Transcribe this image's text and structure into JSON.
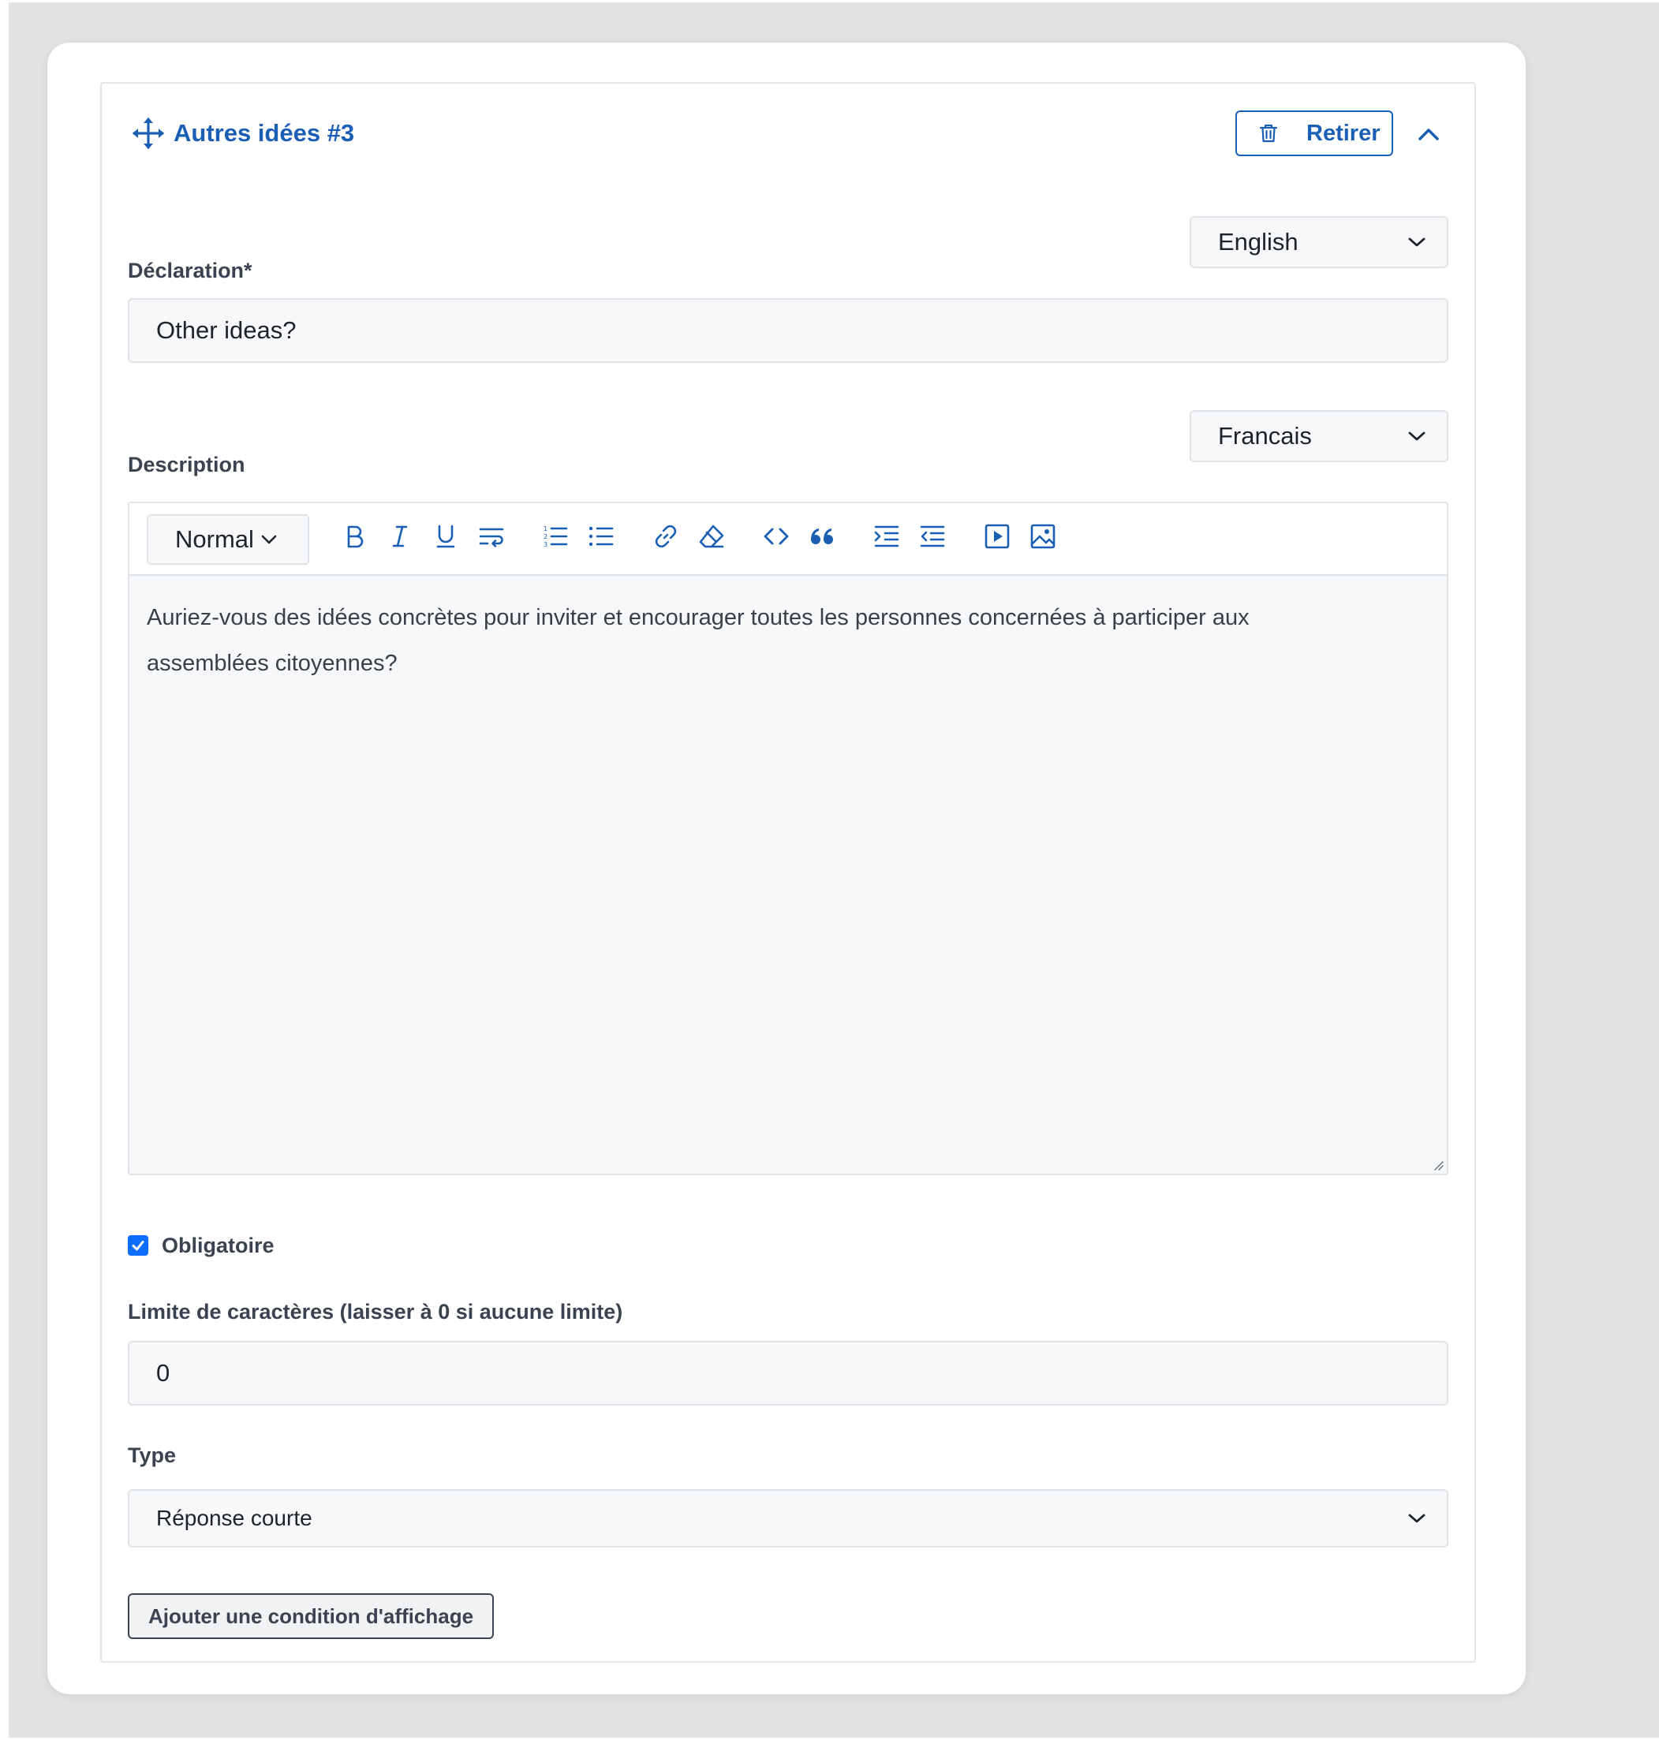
{
  "header": {
    "title": "Autres idées #3",
    "remove_label": "Retirer"
  },
  "statement": {
    "language": "English",
    "label": "Déclaration*",
    "value": "Other ideas?"
  },
  "description": {
    "language": "Francais",
    "label": "Description",
    "format": "Normal",
    "text": "Auriez-vous des idées concrètes pour inviter et encourager toutes les personnes concernées à participer aux assemblées citoyennes?"
  },
  "toolbar_icons": [
    "bold-icon",
    "italic-icon",
    "underline-icon",
    "strikethrough-wrap-icon",
    "ordered-list-icon",
    "bullet-list-icon",
    "link-icon",
    "clear-format-icon",
    "code-icon",
    "blockquote-icon",
    "indent-icon",
    "outdent-icon",
    "video-icon",
    "image-icon"
  ],
  "required": {
    "label": "Obligatoire",
    "checked": true
  },
  "char_limit": {
    "label": "Limite de caractères (laisser à 0 si aucune limite)",
    "value": "0"
  },
  "type": {
    "label": "Type",
    "value": "Réponse courte"
  },
  "add_condition_label": "Ajouter une condition d'affichage",
  "colors": {
    "accent": "#1a5fb4",
    "checkbox": "#0d6efd",
    "background": "#e2e2e2"
  }
}
